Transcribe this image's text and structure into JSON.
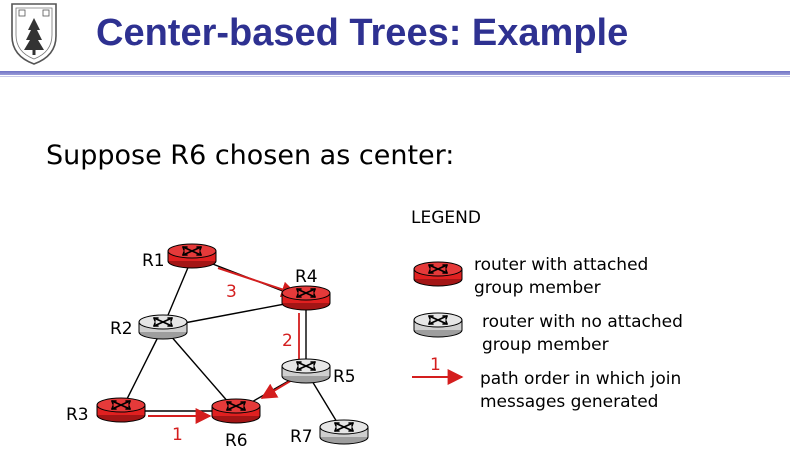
{
  "header": {
    "title": "Center-based Trees: Example"
  },
  "slide": {
    "subtitle": "Suppose R6 chosen as center:"
  },
  "diagram": {
    "routers": [
      {
        "id": "R1",
        "label": "R1",
        "group_member": true
      },
      {
        "id": "R2",
        "label": "R2",
        "group_member": false
      },
      {
        "id": "R3",
        "label": "R3",
        "group_member": true
      },
      {
        "id": "R4",
        "label": "R4",
        "group_member": true
      },
      {
        "id": "R5",
        "label": "R5",
        "group_member": false
      },
      {
        "id": "R6",
        "label": "R6",
        "group_member": true
      },
      {
        "id": "R7",
        "label": "R7",
        "group_member": false
      }
    ],
    "links": [
      [
        "R1",
        "R4"
      ],
      [
        "R1",
        "R2"
      ],
      [
        "R2",
        "R4"
      ],
      [
        "R2",
        "R3"
      ],
      [
        "R2",
        "R6"
      ],
      [
        "R3",
        "R6"
      ],
      [
        "R4",
        "R5"
      ],
      [
        "R5",
        "R6"
      ],
      [
        "R5",
        "R7"
      ]
    ],
    "join_paths": [
      {
        "order": "1",
        "from": "R3",
        "to": "R6"
      },
      {
        "order": "2",
        "from": "R4",
        "to": "R6"
      },
      {
        "order": "3",
        "from": "R1",
        "to": "R4"
      }
    ]
  },
  "legend": {
    "title": "LEGEND",
    "member_text": "router with attached\ngroup member",
    "nonmember_text": "router with no attached\ngroup member",
    "path_sample_number": "1",
    "path_text": "path order in which join\nmessages generated"
  },
  "colors": {
    "title": "#2e3191",
    "member_router": "#e02020",
    "nonmember_router": "#d9d9d9",
    "path_arrow": "#d41e1e"
  }
}
